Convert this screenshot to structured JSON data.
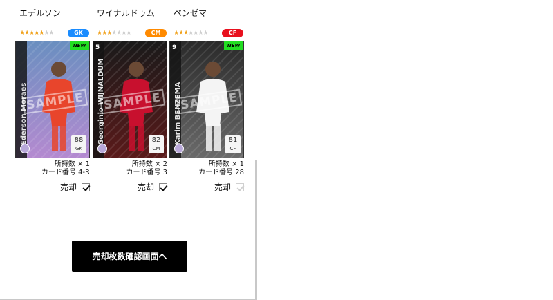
{
  "cards": [
    {
      "name": "エデルソン",
      "stars_on": "★★★★★",
      "stars_off": "★★",
      "position": "GK",
      "position_color": "#1a8cff",
      "is_new": true,
      "new_label": "NEW",
      "vertical_name": "Ederson Moraes",
      "jersey": "",
      "rating": "88",
      "rating_pos": "GK",
      "sample": "SAMPLE",
      "owned": "所持数 × 1",
      "card_number": "カード番号 4-R",
      "sell_label": "売却",
      "sell_checked": true,
      "sell_disabled": false,
      "colors": {
        "bg_top": "#6a8fc0",
        "bg_bottom": "#b48ad0",
        "kit": "#e8452c"
      }
    },
    {
      "name": "ワイナルドゥム",
      "stars_on": "★★★",
      "stars_off": "★★★★",
      "position": "CM",
      "position_color": "#ff8a00",
      "is_new": false,
      "new_label": "",
      "vertical_name": "Georginio WIJNALDUM",
      "jersey": "5",
      "rating": "82",
      "rating_pos": "CM",
      "sample": "SAMPLE",
      "owned": "所持数 × 2",
      "card_number": "カード番号 3",
      "sell_label": "売却",
      "sell_checked": true,
      "sell_disabled": false,
      "colors": {
        "bg_top": "#1a1a1a",
        "bg_bottom": "#5a1a1a",
        "kit": "#c8102e"
      }
    },
    {
      "name": "ベンゼマ",
      "stars_on": "★★★",
      "stars_off": "★★★★",
      "position": "CF",
      "position_color": "#e8101e",
      "is_new": true,
      "new_label": "NEW",
      "vertical_name": "Karim BENZEMA",
      "jersey": "9",
      "rating": "81",
      "rating_pos": "CF",
      "sample": "SAMPLE",
      "owned": "所持数 × 1",
      "card_number": "カード番号 28",
      "sell_label": "売却",
      "sell_checked": false,
      "sell_disabled": true,
      "colors": {
        "bg_top": "#2a2a2a",
        "bg_bottom": "#6a6a6a",
        "kit": "#f4f4f4"
      }
    }
  ],
  "confirm_button": "売却枚数確認画面へ"
}
